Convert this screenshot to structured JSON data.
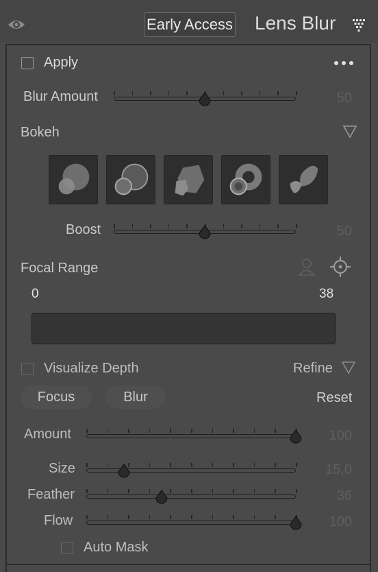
{
  "header": {
    "badge": "Early Access",
    "title": "Lens Blur"
  },
  "panel": {
    "apply_label": "Apply",
    "blur_amount": {
      "label": "Blur Amount",
      "value": "50",
      "level": 0.5
    },
    "bokeh": {
      "label": "Bokeh",
      "options": [
        "bokeh-circle-icon",
        "bokeh-ring-icon",
        "bokeh-blade-icon",
        "bokeh-donut-icon",
        "bokeh-cat-eye-icon"
      ]
    },
    "boost": {
      "label": "Boost",
      "value": "50",
      "level": 0.5
    },
    "focal_range": {
      "label": "Focal Range",
      "min": "0",
      "max": "38"
    },
    "visualize_depth": "Visualize Depth",
    "refine": "Refine",
    "focus": "Focus",
    "blur": "Blur",
    "reset": "Reset",
    "amount": {
      "label": "Amount",
      "value": "100",
      "level": 1.0
    },
    "size": {
      "label": "Size",
      "value": "15,0",
      "level": 0.18
    },
    "feather": {
      "label": "Feather",
      "value": "36",
      "level": 0.36
    },
    "flow": {
      "label": "Flow",
      "value": "100",
      "level": 1.0
    },
    "auto_mask": "Auto Mask"
  },
  "colors": {
    "background": "#4a4a4a",
    "panel_border": "#2b2b2b",
    "dim_value": "#5f5f5f"
  }
}
